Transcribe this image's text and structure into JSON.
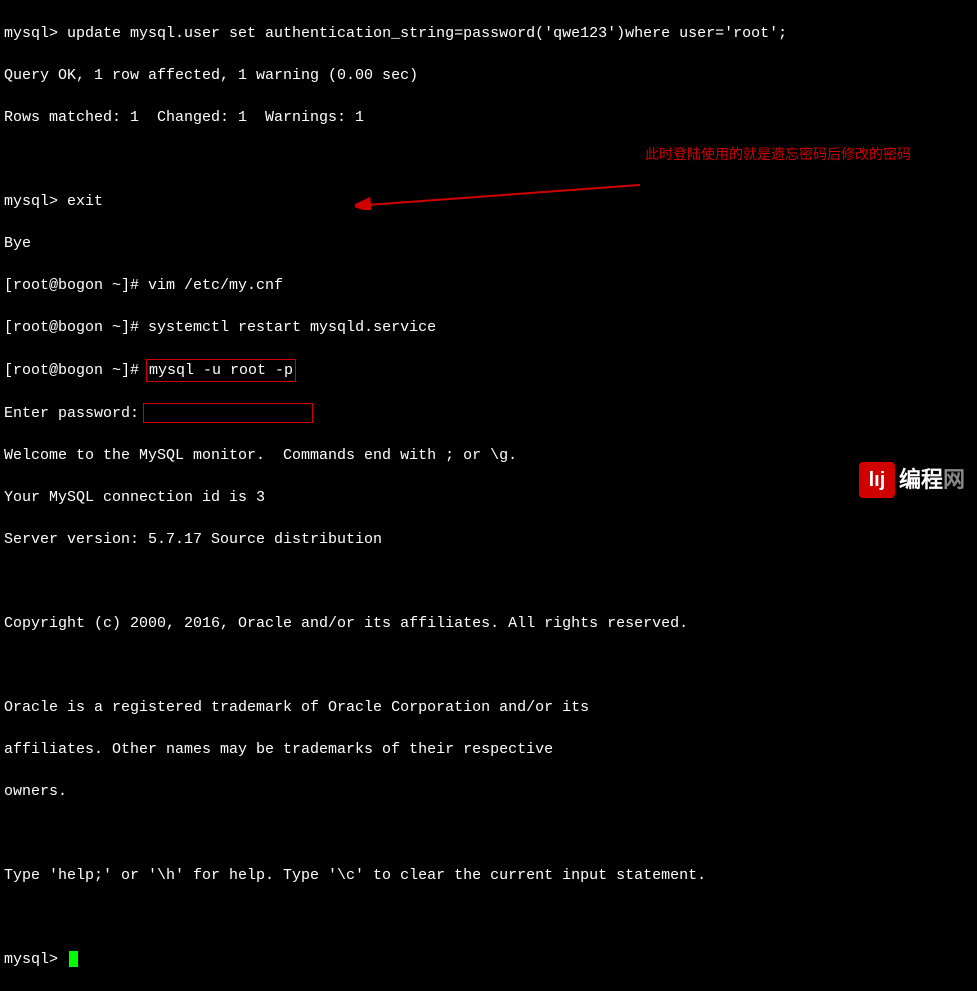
{
  "terminal": {
    "line1_prompt": "mysql> ",
    "line1_cmd": "update mysql.user set authentication_string=password('qwe123')where user='root';",
    "line2": "Query OK, 1 row affected, 1 warning (0.00 sec)",
    "line3": "Rows matched: 1  Changed: 1  Warnings: 1",
    "line4": "",
    "line5_prompt": "mysql> ",
    "line5_cmd": "exit",
    "line6": "Bye",
    "line7_prompt": "[root@bogon ~]# ",
    "line7_cmd": "vim /etc/my.cnf",
    "line8_prompt": "[root@bogon ~]# ",
    "line8_cmd": "systemctl restart mysqld.service",
    "line9_prompt": "[root@bogon ~]# ",
    "line9_cmd": "mysql -u root -p",
    "line10_prompt": "Enter password:",
    "line11": "Welcome to the MySQL monitor.  Commands end with ; or \\g.",
    "line12": "Your MySQL connection id is 3",
    "line13": "Server version: 5.7.17 Source distribution",
    "line14": "",
    "line15": "Copyright (c) 2000, 2016, Oracle and/or its affiliates. All rights reserved.",
    "line16": "",
    "line17": "Oracle is a registered trademark of Oracle Corporation and/or its",
    "line18": "affiliates. Other names may be trademarks of their respective",
    "line19": "owners.",
    "line20": "",
    "line21": "Type 'help;' or '\\h' for help. Type '\\c' to clear the current input statement.",
    "line22": "",
    "line23_prompt": "mysql> "
  },
  "annotation": {
    "text": "此时登陆使用的就是遗忘密码后修改的密码"
  },
  "logo": {
    "icon_text": "lıj",
    "text_white": "编程",
    "text_gray": "网"
  }
}
